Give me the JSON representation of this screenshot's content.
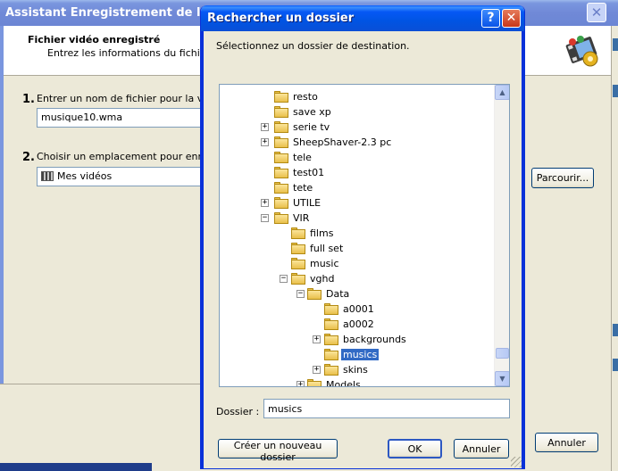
{
  "background_window": {
    "title": "Assistant Enregistrement de la vid",
    "header_title": "Fichier vidéo enregistré",
    "header_subtitle": "Entrez les informations du fichier vidé",
    "step1": {
      "number": "1.",
      "label": "Entrer un nom de fichier pour la vidéo",
      "value": "musique10.wma"
    },
    "step2": {
      "number": "2.",
      "label": "Choisir un emplacement pour enregistr",
      "value": "Mes vidéos"
    },
    "browse_button": "Parcourir...",
    "cancel_button": "Annuler",
    "close_icon": "close-icon",
    "logo_icon": "movie-maker-logo-icon"
  },
  "dialog": {
    "title": "Rechercher un dossier",
    "help_glyph": "?",
    "close_glyph": "✕",
    "instruction": "Sélectionnez un dossier de destination.",
    "tree": [
      {
        "label": "resto",
        "level": 0,
        "toggle": ""
      },
      {
        "label": "save xp",
        "level": 0,
        "toggle": ""
      },
      {
        "label": "serie tv",
        "level": 0,
        "toggle": "+"
      },
      {
        "label": "SheepShaver-2.3 pc",
        "level": 0,
        "toggle": "+"
      },
      {
        "label": "tele",
        "level": 0,
        "toggle": ""
      },
      {
        "label": "test01",
        "level": 0,
        "toggle": ""
      },
      {
        "label": "tete",
        "level": 0,
        "toggle": ""
      },
      {
        "label": "UTILE",
        "level": 0,
        "toggle": "+"
      },
      {
        "label": "VIR",
        "level": 0,
        "toggle": "−"
      },
      {
        "label": "films",
        "level": 1,
        "toggle": ""
      },
      {
        "label": "full set",
        "level": 1,
        "toggle": ""
      },
      {
        "label": "music",
        "level": 1,
        "toggle": ""
      },
      {
        "label": "vghd",
        "level": 1,
        "toggle": "−"
      },
      {
        "label": "Data",
        "level": 2,
        "toggle": "−"
      },
      {
        "label": "a0001",
        "level": 3,
        "toggle": ""
      },
      {
        "label": "a0002",
        "level": 3,
        "toggle": ""
      },
      {
        "label": "backgrounds",
        "level": 3,
        "toggle": "+"
      },
      {
        "label": "musics",
        "level": 3,
        "toggle": "",
        "selected": true
      },
      {
        "label": "skins",
        "level": 3,
        "toggle": "+"
      },
      {
        "label": "Models",
        "level": 2,
        "toggle": "+"
      }
    ],
    "folder_label": "Dossier :",
    "folder_value": "musics",
    "new_folder_button": "Créer un nouveau dossier",
    "ok_button": "OK",
    "cancel_button": "Annuler"
  }
}
